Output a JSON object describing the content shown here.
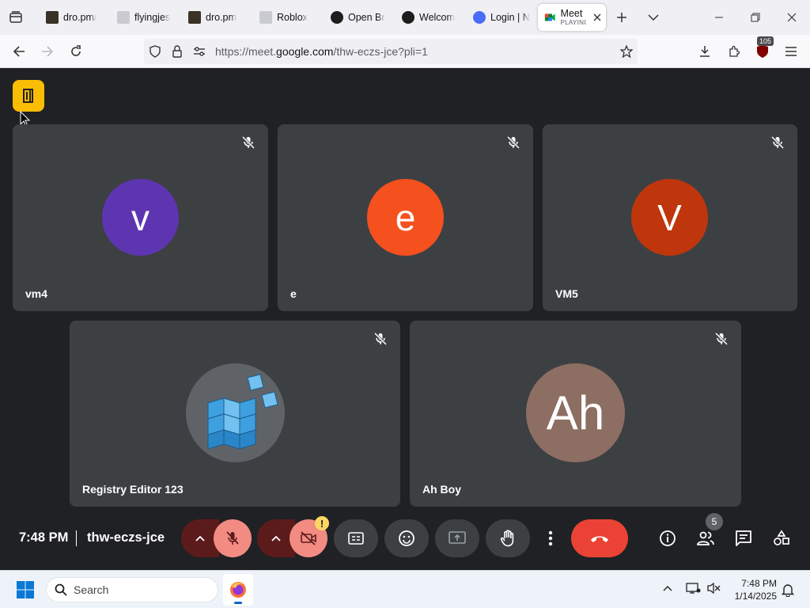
{
  "browser": {
    "tabs": [
      {
        "label": "dro.pm/",
        "favicon_color": "#3a3226"
      },
      {
        "label": "flyingjes",
        "favicon_color": "#c9cbd1"
      },
      {
        "label": "dro.pm",
        "favicon_color": "#3a3226"
      },
      {
        "label": "Roblox",
        "favicon_color": "#c9cbd1"
      },
      {
        "label": "Open Br",
        "favicon_color": "#1d1d1d"
      },
      {
        "label": "Welcom",
        "favicon_color": "#1d1d1d"
      },
      {
        "label": "Login | N",
        "favicon_color": "#4a6cf7"
      }
    ],
    "active_tab": {
      "label": "Meet",
      "sublabel": "PLAYING"
    },
    "url": {
      "prefix": "https://meet.",
      "host": "google.com",
      "path": "/thw-eczs-jce?pli=1"
    },
    "extension_badge": "105"
  },
  "meeting": {
    "time": "7:48 PM",
    "code": "thw-eczs-jce",
    "participants_count": "5",
    "participants": [
      {
        "name": "vm4",
        "initial": "v",
        "color": "#5e35b1"
      },
      {
        "name": "e",
        "initial": "e",
        "color": "#f4511e"
      },
      {
        "name": "VM5",
        "initial": "V",
        "color": "#bf360c"
      },
      {
        "name": "Registry Editor 123",
        "initial": "",
        "color": "#5f6368"
      },
      {
        "name": "Ah Boy",
        "initial": "Ah",
        "color": "#8d6e63"
      }
    ],
    "warning_mark": "!"
  },
  "taskbar": {
    "search_placeholder": "Search",
    "time": "7:48 PM",
    "date": "1/14/2025"
  },
  "colors": {
    "meet_bg": "#202124",
    "tile_bg": "#3c4043",
    "end_call": "#ea4335",
    "door_button": "#fbbc04"
  }
}
